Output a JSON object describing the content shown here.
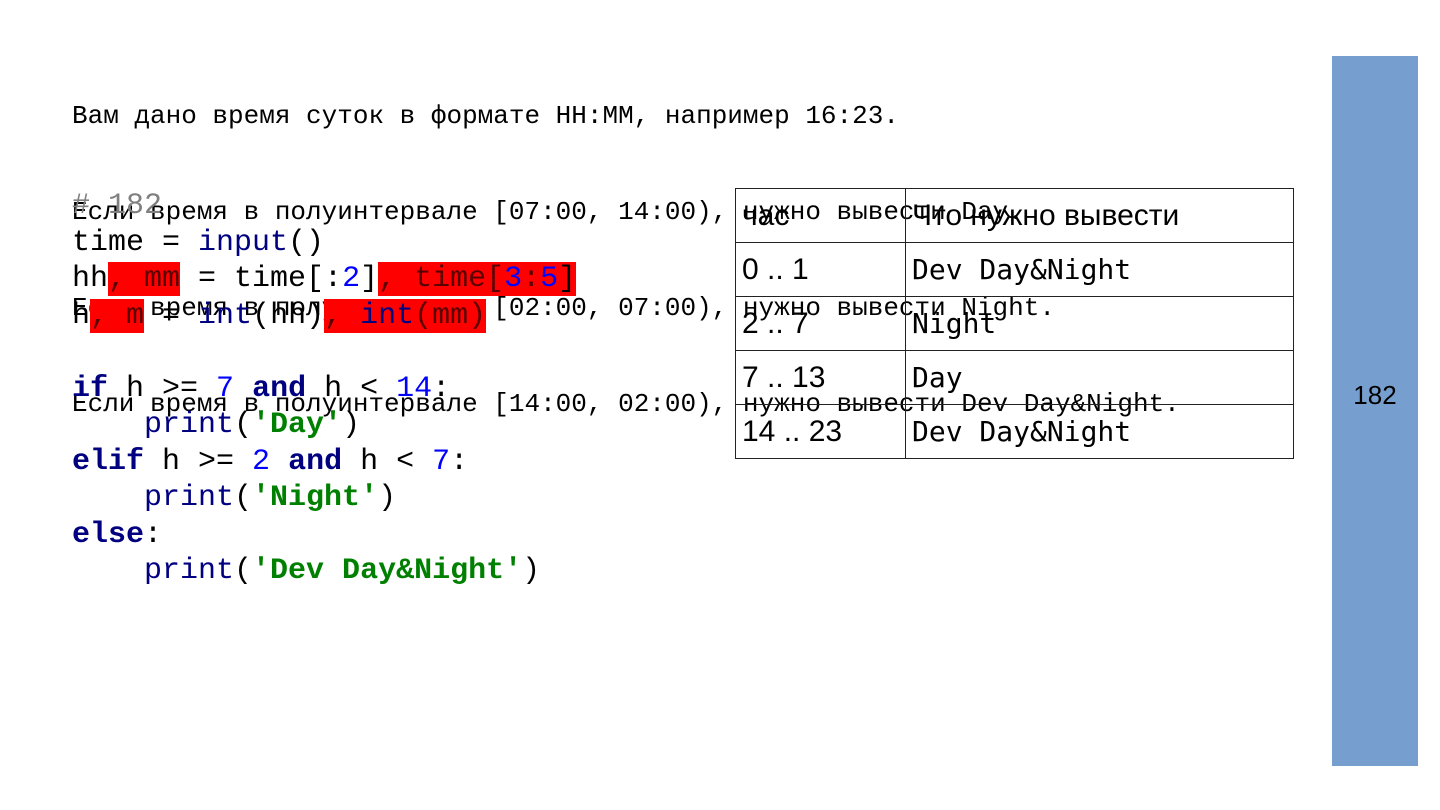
{
  "task": {
    "lines": [
      "Вам дано время суток в формате HH:MM, например 16:23.",
      "Если время в полуинтервале [07:00, 14:00), нужно вывести Day.",
      "Если время в полуинтервале [02:00, 07:00), нужно вывести Night.",
      "Если время в полуинтервале [14:00, 02:00), нужно вывести Dev Day&Night."
    ]
  },
  "code": {
    "comment": "# 182",
    "line1": {
      "var": "time",
      "op": " = ",
      "fn": "input",
      "paren": "()"
    },
    "line2": {
      "a": "hh",
      "hl1": ", mm",
      "b": " = time[:",
      "n1": "2",
      "c": "]",
      "hl2a": ", time[",
      "n2": "3",
      "colon": ":",
      "n3": "5",
      "hl2b": "]"
    },
    "line3": {
      "a": "h",
      "hl1": ", m",
      "b": " = ",
      "fn": "int",
      "c": "(hh)",
      "hl2a": ", ",
      "fn2": "int",
      "hl2b": "(mm)"
    },
    "line5": {
      "kw": "if",
      "a": " h >= ",
      "n1": "7",
      "sp": " ",
      "kw2": "and",
      "b": " h < ",
      "n2": "14",
      "c": ":"
    },
    "line6": {
      "indent": "    ",
      "fn": "print",
      "o": "(",
      "str": "'Day'",
      "cl": ")"
    },
    "line7": {
      "kw": "elif",
      "a": " h >= ",
      "n1": "2",
      "sp": " ",
      "kw2": "and",
      "b": " h < ",
      "n2": "7",
      "c": ":"
    },
    "line8": {
      "indent": "    ",
      "fn": "print",
      "o": "(",
      "str": "'Night'",
      "cl": ")"
    },
    "line9": {
      "kw": "else",
      "c": ":"
    },
    "line10": {
      "indent": "    ",
      "fn": "print",
      "o": "(",
      "str": "'Dev Day&Night'",
      "cl": ")"
    }
  },
  "table": {
    "headers": [
      "час",
      "Что нужно вывести"
    ],
    "rows": [
      [
        "0 .. 1",
        "Dev Day&Night"
      ],
      [
        "2 .. 7",
        "Night"
      ],
      [
        "7 .. 13",
        "Day"
      ],
      [
        "14 .. 23",
        "Dev Day&Night"
      ]
    ]
  },
  "sidebar": {
    "number": "182",
    "color": "#769fcf"
  },
  "colors": {
    "highlight": "#ff0000",
    "keyword": "#000080",
    "string": "#008000",
    "number": "#0000ff",
    "comment": "#808080"
  }
}
